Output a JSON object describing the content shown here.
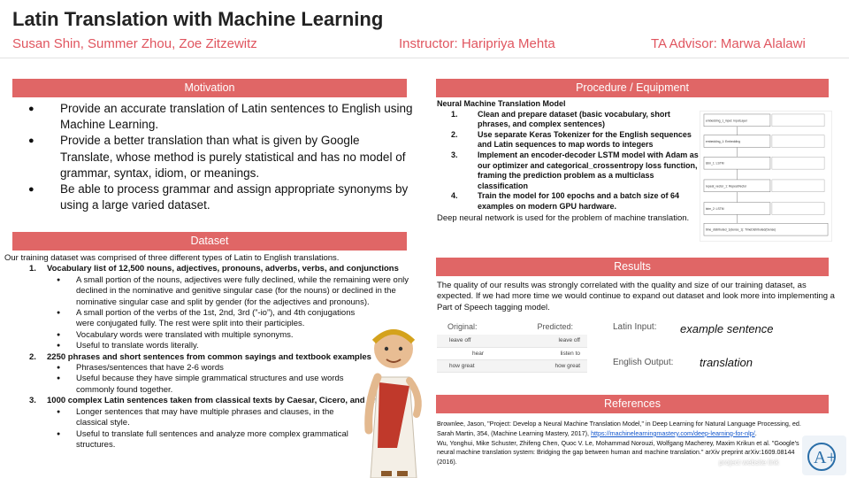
{
  "header": {
    "title": "Latin Translation with Machine Learning",
    "authors": "Susan Shin, Summer Zhou, Zoe Zitzewitz",
    "instructor": "Instructor: Haripriya Mehta",
    "ta": "TA Advisor: Marwa Alalawi"
  },
  "motivation": {
    "heading": "Motivation",
    "bullets": [
      "Provide an accurate translation of Latin sentences to English using Machine Learning.",
      "Provide a better translation than what is given by Google Translate, whose method is purely statistical and has no model of grammar, syntax, idiom, or meanings.",
      "Be able to process grammar and assign appropriate synonyms by using a large varied dataset."
    ]
  },
  "dataset": {
    "heading": "Dataset",
    "intro": "Our training dataset was comprised of three different types of Latin to English translations.",
    "items": [
      {
        "num": "1.",
        "title": "Vocabulary list of 12,500 nouns, adjectives, pronouns, adverbs, verbs, and conjunctions",
        "bullets": [
          "A small portion of the nouns, adjectives were fully declined, while the remaining were only declined in the nominative and genitive singular case (for the nouns) or declined in the nominative singular case and split by gender (for the adjectives and pronouns).",
          "A small portion  of the verbs of the 1st, 2nd, 3rd (”-io”), and 4th conjugations were conjugated fully.  The rest were split into their participles.",
          "Vocabulary words were translated with multiple synonyms.",
          "Useful to translate words literally."
        ]
      },
      {
        "num": "2.",
        "title": "2250 phrases and short sentences from common sayings and textbook examples",
        "bullets": [
          "Phrases/sentences that have 2-6 words",
          "Useful because they have simple grammatical structures and use words commonly found together."
        ]
      },
      {
        "num": "3.",
        "title": "1000 complex Latin sentences taken from classical texts by Caesar, Cicero, and Virgil",
        "bullets": [
          "Longer sentences that may have multiple phrases and clauses, in the classical style.",
          "Useful to translate full sentences and analyze more complex grammatical structures."
        ]
      }
    ]
  },
  "procedure": {
    "heading": "Procedure / Equipment",
    "subheading": "Neural Machine Translation Model",
    "steps": [
      {
        "num": "1.",
        "text": "Clean and prepare dataset (basic vocabulary, short phrases, and complex sentences)"
      },
      {
        "num": "2.",
        "text": "Use separate Keras Tokenizer for the English sequences and Latin sequences to map words to integers"
      },
      {
        "num": "3.",
        "text": "Implement an encoder-decoder LSTM model with Adam as our optimizer and categorical_crossentropy loss function, framing the prediction problem as a multiclass classification"
      },
      {
        "num": "4.",
        "text": "Train the model for 100 epochs and a batch size of 64 examples on modern GPU hardware."
      }
    ],
    "note": "Deep neural network is used for the problem of machine translation.",
    "diagram_layers": [
      "embedding_1_input: InputLayer",
      "embedding_1: Embedding",
      "lstm_1: LSTM",
      "repeat_vector_1: RepeatVector",
      "lstm_2: LSTM",
      "time_distributed_1(dense_1): TimeDistributed(Dense)"
    ]
  },
  "results": {
    "heading": "Results",
    "text": "The quality of our results was strongly correlated with the quality and size of our training dataset, as expected.  If we had more time we would continue to expand out dataset and look more into implementing a Part of Speech tagging model.",
    "original_label": "Original:",
    "predicted_label": "Predicted:",
    "rows": [
      {
        "original": "leave off",
        "predicted": "leave off"
      },
      {
        "original": "hear",
        "predicted": "listen to"
      },
      {
        "original": "how great",
        "predicted": "how great"
      }
    ],
    "latin_input_label": "Latin Input:",
    "latin_input_value": "example sentence",
    "english_output_label": "English Output:",
    "english_output_value": "translation"
  },
  "references": {
    "heading": "References",
    "ref1_text": "Brownlee, Jason, \"Project: Develop a Neural Machine Translation Model,\" in Deep Learning for Natural Language Processing, ed. Sarah Martin, 354, (Machine Learning Mastery, 2017), ",
    "ref1_link": "https://machinelearningmastery.com/deep-learning-for-nlp/",
    "ref1_end": ".",
    "ref2_text": "Wu, Yonghui, Mike Schuster, Zhifeng Chen, Quoc V. Le, Mohammad Norouzi, Wolfgang Macherey, Maxim Krikun et al. \"Google's neural machine translation system: Bridging the gap between human and machine translation.\" arXiv preprint arXiv:1609.08144 (2016)."
  },
  "footer": {
    "logo_text": "A+",
    "project_site": "project website link"
  },
  "colors": {
    "accent": "#e06666",
    "subtitle": "#e0555f",
    "link": "#1155cc"
  }
}
